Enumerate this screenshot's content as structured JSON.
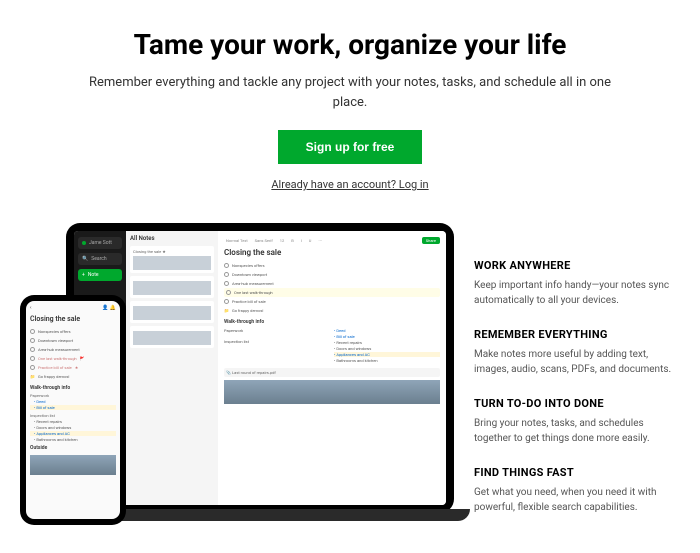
{
  "hero": {
    "title": "Tame your work, organize your life",
    "subtitle": "Remember everything and tackle any project with your notes, tasks, and schedule all in one place.",
    "cta": "Sign up for free",
    "login": "Already have an account? Log in"
  },
  "laptop": {
    "sidebar": {
      "user": "Jame Sott",
      "search": "Search",
      "note": "Note"
    },
    "notes": {
      "header": "All Notes",
      "card_title": "Closing the sale"
    },
    "main": {
      "share": "Share",
      "title": "Closing the sale",
      "tasks": {
        "t1": "Nonspecies offers",
        "t2": "Downtown viewport",
        "t3": "Area-hub measurement",
        "t4": "One last walk-through",
        "t5": "Practice bill of sale",
        "t6": "Go frappy demos!"
      },
      "section": "Walk-through info",
      "cols": {
        "c1": "Paperwork",
        "c2": "Inspection list"
      },
      "bullets": {
        "b1": "Deed",
        "b2": "Bill of sale",
        "b3": "Recent repairs",
        "b4": "Doors and windows",
        "b5": "Appliances and AC",
        "b6": "Bathrooms and kitchen"
      },
      "attach": "Last round of repairs.pdf"
    }
  },
  "phone": {
    "title": "Closing the sale",
    "tasks": {
      "t1": "Nonspecies offers",
      "t2": "Downtown viewport",
      "t3": "Area-hub measurement",
      "t4": "One last walk-through",
      "t5": "Practice bill of sale",
      "t6": "Go frappy demos!"
    },
    "section": "Walk-through info",
    "cols": {
      "c1": "Paperwork",
      "c2": "Inspection list"
    },
    "bullets": {
      "b1": "Deed",
      "b2": "Bill of sale",
      "b3": "Recent repairs",
      "b4": "Doors and windows",
      "b5": "Appliances and AC",
      "b6": "Bathrooms and kitchen"
    },
    "outside": "Outside"
  },
  "features": [
    {
      "title": "WORK ANYWHERE",
      "body": "Keep important info handy—your notes sync automatically to all your devices."
    },
    {
      "title": "REMEMBER EVERYTHING",
      "body": "Make notes more useful by adding text, images, audio, scans, PDFs, and documents."
    },
    {
      "title": "TURN TO-DO INTO DONE",
      "body": "Bring your notes, tasks, and schedules together to get things done more easily."
    },
    {
      "title": "FIND THINGS FAST",
      "body": "Get what you need, when you need it with powerful, flexible search capabilities."
    }
  ]
}
